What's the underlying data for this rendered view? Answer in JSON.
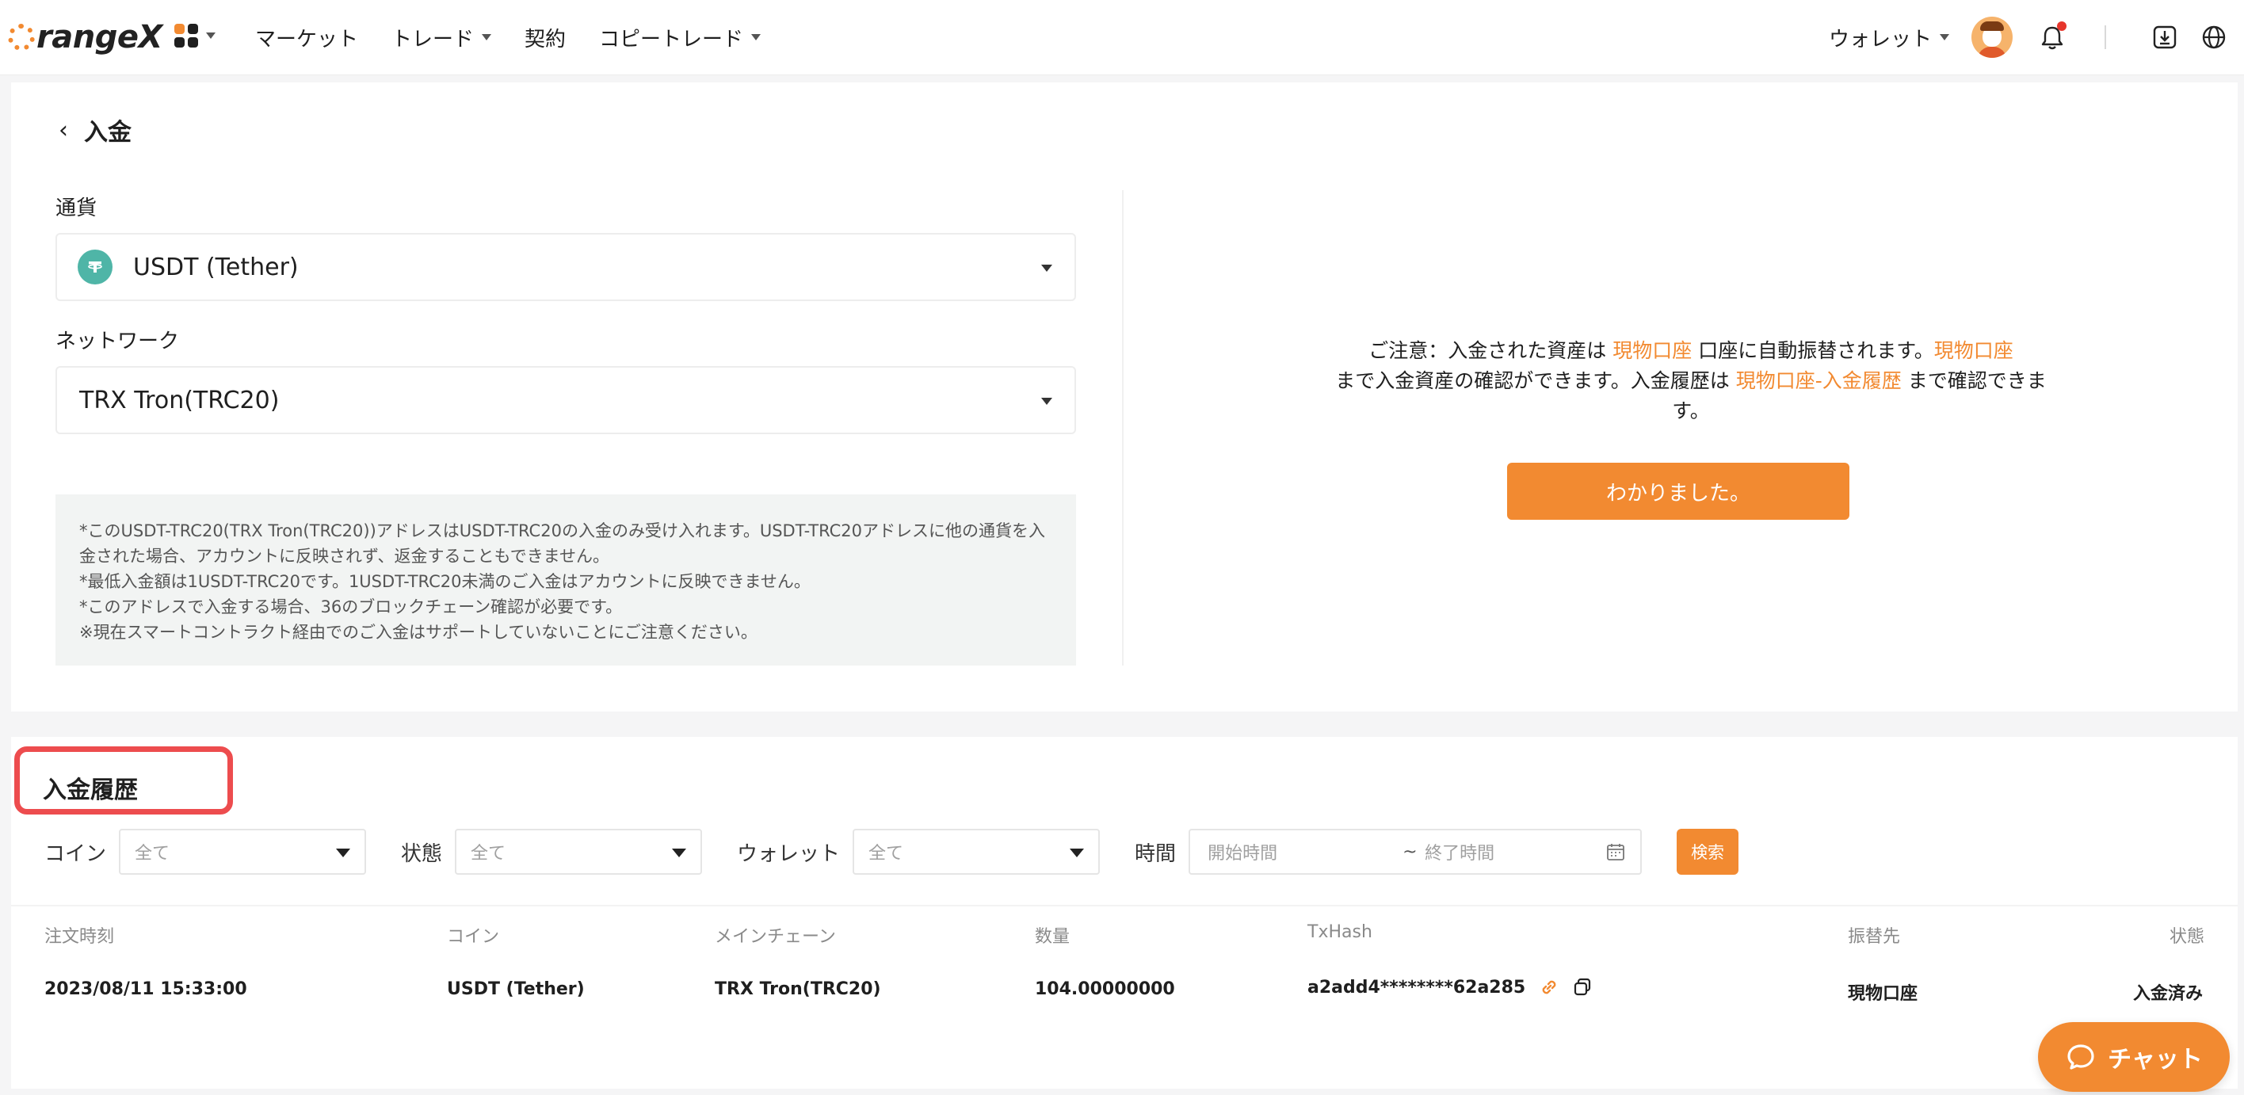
{
  "header": {
    "logo_text": "rangeX",
    "nav": [
      {
        "label": "マーケット",
        "has_caret": false
      },
      {
        "label": "トレード",
        "has_caret": true
      },
      {
        "label": "契約",
        "has_caret": false
      },
      {
        "label": "コピートレード",
        "has_caret": true
      }
    ],
    "wallet_label": "ウォレット"
  },
  "deposit": {
    "title": "入金",
    "currency_label": "通貨",
    "currency_value": "USDT (Tether)",
    "network_label": "ネットワーク",
    "network_value": "TRX Tron(TRC20)",
    "notices": [
      "*このUSDT-TRC20(TRX Tron(TRC20))アドレスはUSDT-TRC20の入金のみ受け入れます。USDT-TRC20アドレスに他の通貨を入",
      "金された場合、アカウントに反映されず、返金することもできません。",
      "*最低入金額は1USDT-TRC20です。1USDT-TRC20未満のご入金はアカウントに反映できません。",
      "*このアドレスで入金する場合、36のブロックチェーン確認が必要です。",
      "※現在スマートコントラクト経由でのご入金はサポートしていないことにご注意ください。"
    ],
    "attention": {
      "part1": "ご注意：入金された資産は ",
      "link1": "現物口座",
      "part2": " 口座に自動振替されます。",
      "link2": "現物口座",
      "part3": "まで入金資産の確認ができます。入金履歴は ",
      "link3": "現物口座-入金履歴",
      "part4": " まで確認できます。"
    },
    "ok_button": "わかりました。"
  },
  "history": {
    "title": "入金履歴",
    "filters": {
      "coin_label": "コイン",
      "coin_value": "全て",
      "status_label": "状態",
      "status_value": "全て",
      "wallet_label": "ウォレット",
      "wallet_value": "全て",
      "time_label": "時間",
      "start_placeholder": "開始時間",
      "tilde": "~",
      "end_placeholder": "終了時間",
      "search_button": "検索"
    },
    "columns": [
      "注文時刻",
      "コイン",
      "メインチェーン",
      "数量",
      "TxHash",
      "振替先",
      "状態"
    ],
    "rows": [
      {
        "time": "2023/08/11 15:33:00",
        "coin": "USDT (Tether)",
        "chain": "TRX Tron(TRC20)",
        "amount": "104.00000000",
        "txhash": "a2add4********62a285",
        "destination": "現物口座",
        "status": "入金済み"
      }
    ]
  },
  "chat_button": "チャット",
  "colors": {
    "accent": "#f28a31",
    "highlight_border": "#ed4c4e",
    "usdt": "#4fb5a7"
  }
}
